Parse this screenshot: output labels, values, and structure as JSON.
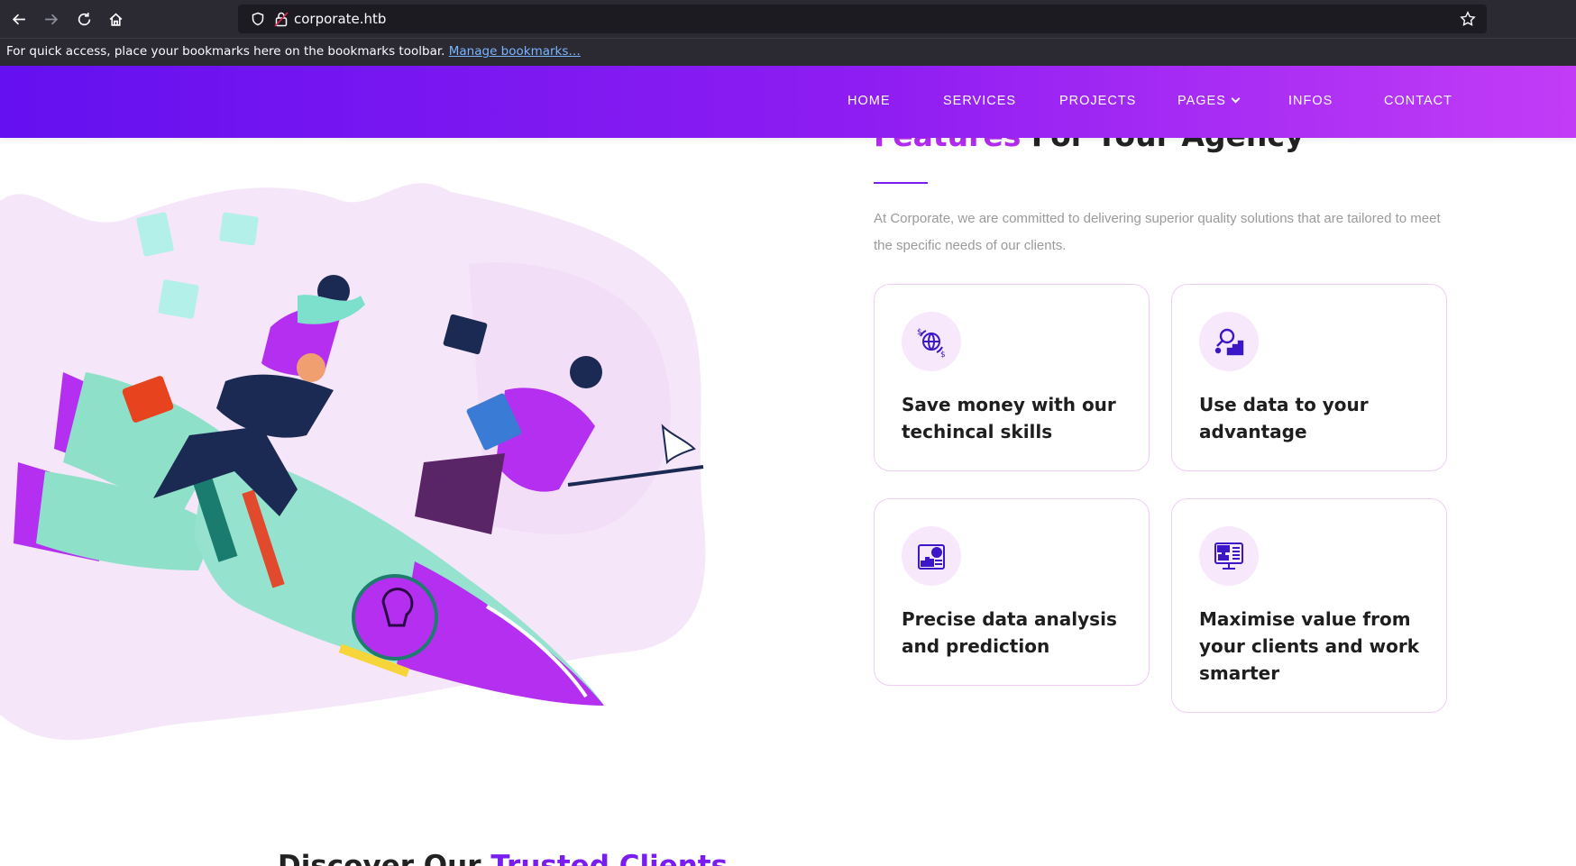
{
  "browser": {
    "url": "corporate.htb",
    "bookmarks_message": "For quick access, place your bookmarks here on the bookmarks toolbar.",
    "bookmarks_link": "Manage bookmarks…",
    "icons": [
      "back-arrow-icon",
      "forward-arrow-icon",
      "reload-icon",
      "home-icon",
      "shield-icon",
      "lock-icon",
      "star-icon"
    ]
  },
  "nav": {
    "items": [
      {
        "label": "HOME"
      },
      {
        "label": "SERVICES"
      },
      {
        "label": "PROJECTS"
      },
      {
        "label": "PAGES"
      },
      {
        "label": "INFOS"
      },
      {
        "label": "CONTACT"
      }
    ]
  },
  "features": {
    "title_accent": "Features",
    "title_rest": " For Your Agency",
    "lead": "At Corporate, we are committed to delivering superior quality solutions that are tailored to meet the specific needs of our clients.",
    "cards": [
      {
        "icon": "globe-money-icon",
        "title": "Save money with our techincal skills"
      },
      {
        "icon": "data-search-icon",
        "title": "Use data to your advantage"
      },
      {
        "icon": "report-chart-icon",
        "title": "Precise data analysis and prediction"
      },
      {
        "icon": "ads-monitor-icon",
        "title": "Maximise value from your clients and work smarter"
      }
    ]
  },
  "clients": {
    "title_plain": "Discover Our ",
    "title_accent": "Trusted Clients"
  },
  "colors": {
    "header_start": "#6410f0",
    "header_end": "#c23cf6",
    "accent_purple": "#b22bf0",
    "accent_violet": "#7a1df0"
  }
}
